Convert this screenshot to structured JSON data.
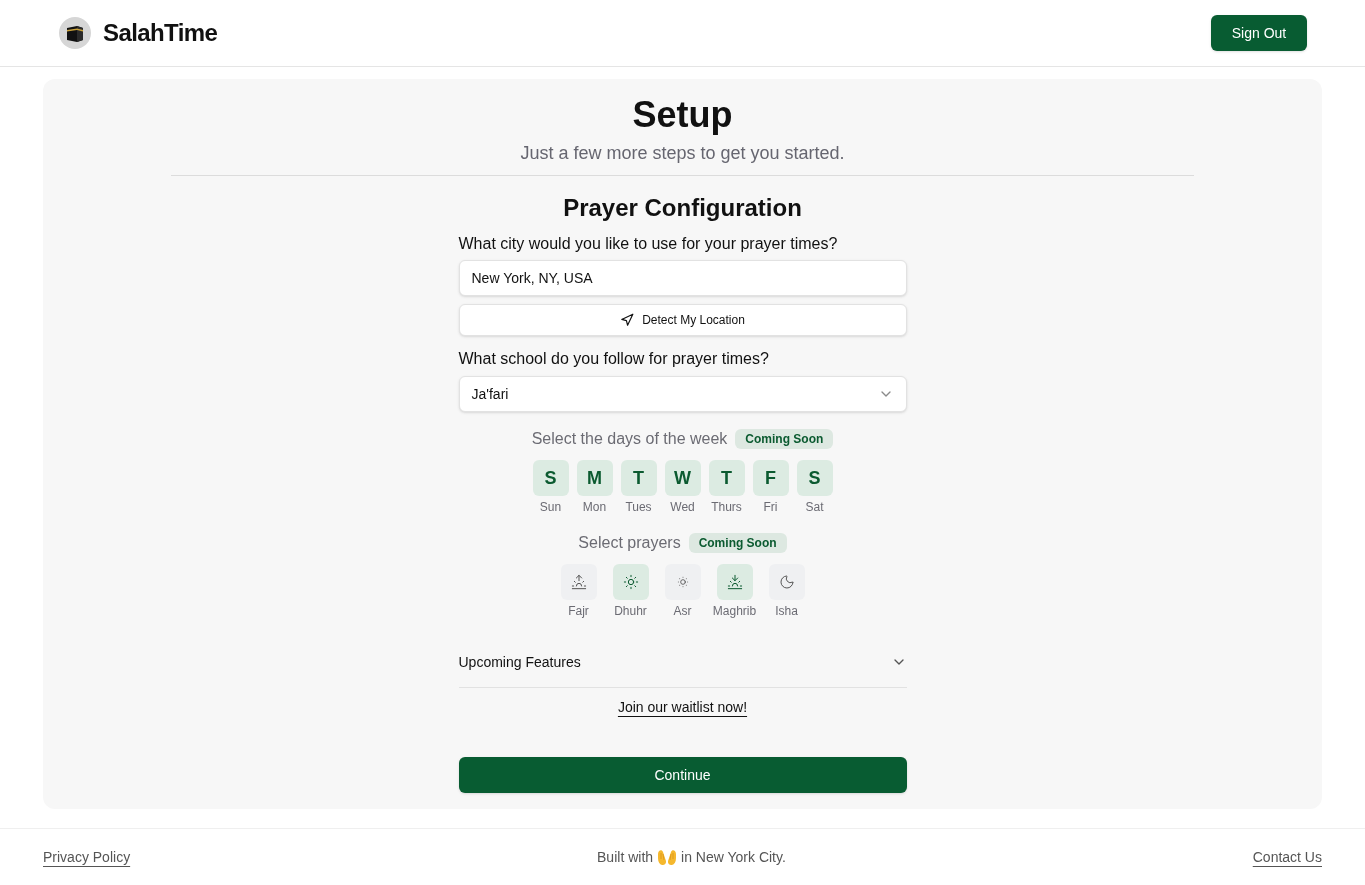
{
  "header": {
    "brand": "SalahTime",
    "sign_out": "Sign Out"
  },
  "setup": {
    "title": "Setup",
    "subtitle": "Just a few more steps to get you started."
  },
  "prayer_configuration": {
    "title": "Prayer Configuration",
    "city": {
      "label": "What city would you like to use for your prayer times?",
      "value": "New York, NY, USA"
    },
    "detect_button": "Detect My Location",
    "school": {
      "label": "What school do you follow for prayer times?",
      "value": "Ja'fari"
    },
    "days": {
      "label": "Select the days of the week",
      "badge": "Coming Soon",
      "items": [
        {
          "letter": "S",
          "name": "Sun",
          "selected": true
        },
        {
          "letter": "M",
          "name": "Mon",
          "selected": true
        },
        {
          "letter": "T",
          "name": "Tues",
          "selected": true
        },
        {
          "letter": "W",
          "name": "Wed",
          "selected": true
        },
        {
          "letter": "T",
          "name": "Thurs",
          "selected": true
        },
        {
          "letter": "F",
          "name": "Fri",
          "selected": true
        },
        {
          "letter": "S",
          "name": "Sat",
          "selected": true
        }
      ]
    },
    "prayers": {
      "label": "Select prayers",
      "badge": "Coming Soon",
      "items": [
        {
          "name": "Fajr",
          "selected": false
        },
        {
          "name": "Dhuhr",
          "selected": true
        },
        {
          "name": "Asr",
          "selected": false
        },
        {
          "name": "Maghrib",
          "selected": true
        },
        {
          "name": "Isha",
          "selected": false
        }
      ]
    },
    "upcoming_features": {
      "label": "Upcoming Features",
      "expanded": false
    },
    "waitlist_link": "Join our waitlist now!",
    "continue_button": "Continue"
  },
  "footer": {
    "privacy_link": "Privacy Policy",
    "credit_before": "Built with",
    "credit_after": "in New York City.",
    "contact_link": "Contact Us"
  }
}
